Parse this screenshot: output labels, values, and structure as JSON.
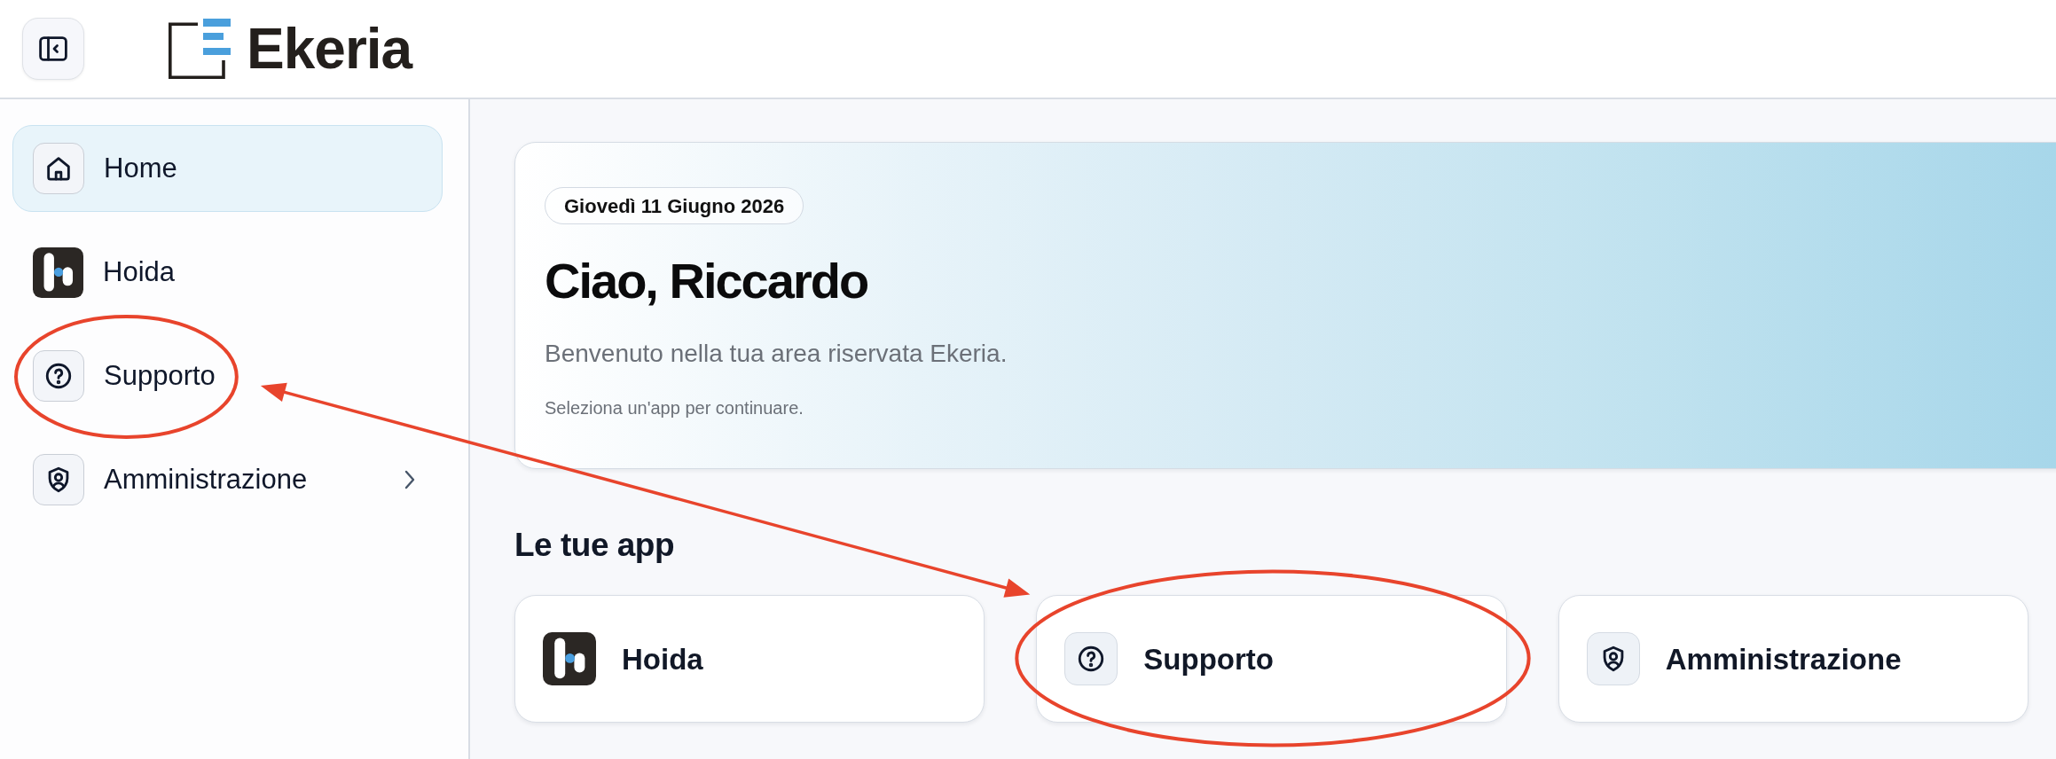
{
  "header": {
    "brand": "Ekeria"
  },
  "sidebar": {
    "items": [
      {
        "kind": "home",
        "label": "Home",
        "selected": true,
        "has_submenu": false,
        "circled": false
      },
      {
        "kind": "hoida",
        "label": "Hoida",
        "selected": false,
        "has_submenu": false,
        "circled": false
      },
      {
        "kind": "support",
        "label": "Supporto",
        "selected": false,
        "has_submenu": false,
        "circled": true
      },
      {
        "kind": "admin",
        "label": "Amministrazione",
        "selected": false,
        "has_submenu": true,
        "circled": false
      }
    ]
  },
  "hero": {
    "date": "Giovedì 11 Giugno 2026",
    "greeting": "Ciao, Riccardo",
    "welcome": "Benvenuto nella tua area riservata Ekeria.",
    "hint": "Seleziona un'app per continuare."
  },
  "apps": {
    "title": "Le tue app",
    "items": [
      {
        "kind": "hoida",
        "label": "Hoida",
        "circled": false
      },
      {
        "kind": "support",
        "label": "Supporto",
        "circled": true
      },
      {
        "kind": "admin",
        "label": "Amministrazione",
        "circled": false
      }
    ]
  }
}
